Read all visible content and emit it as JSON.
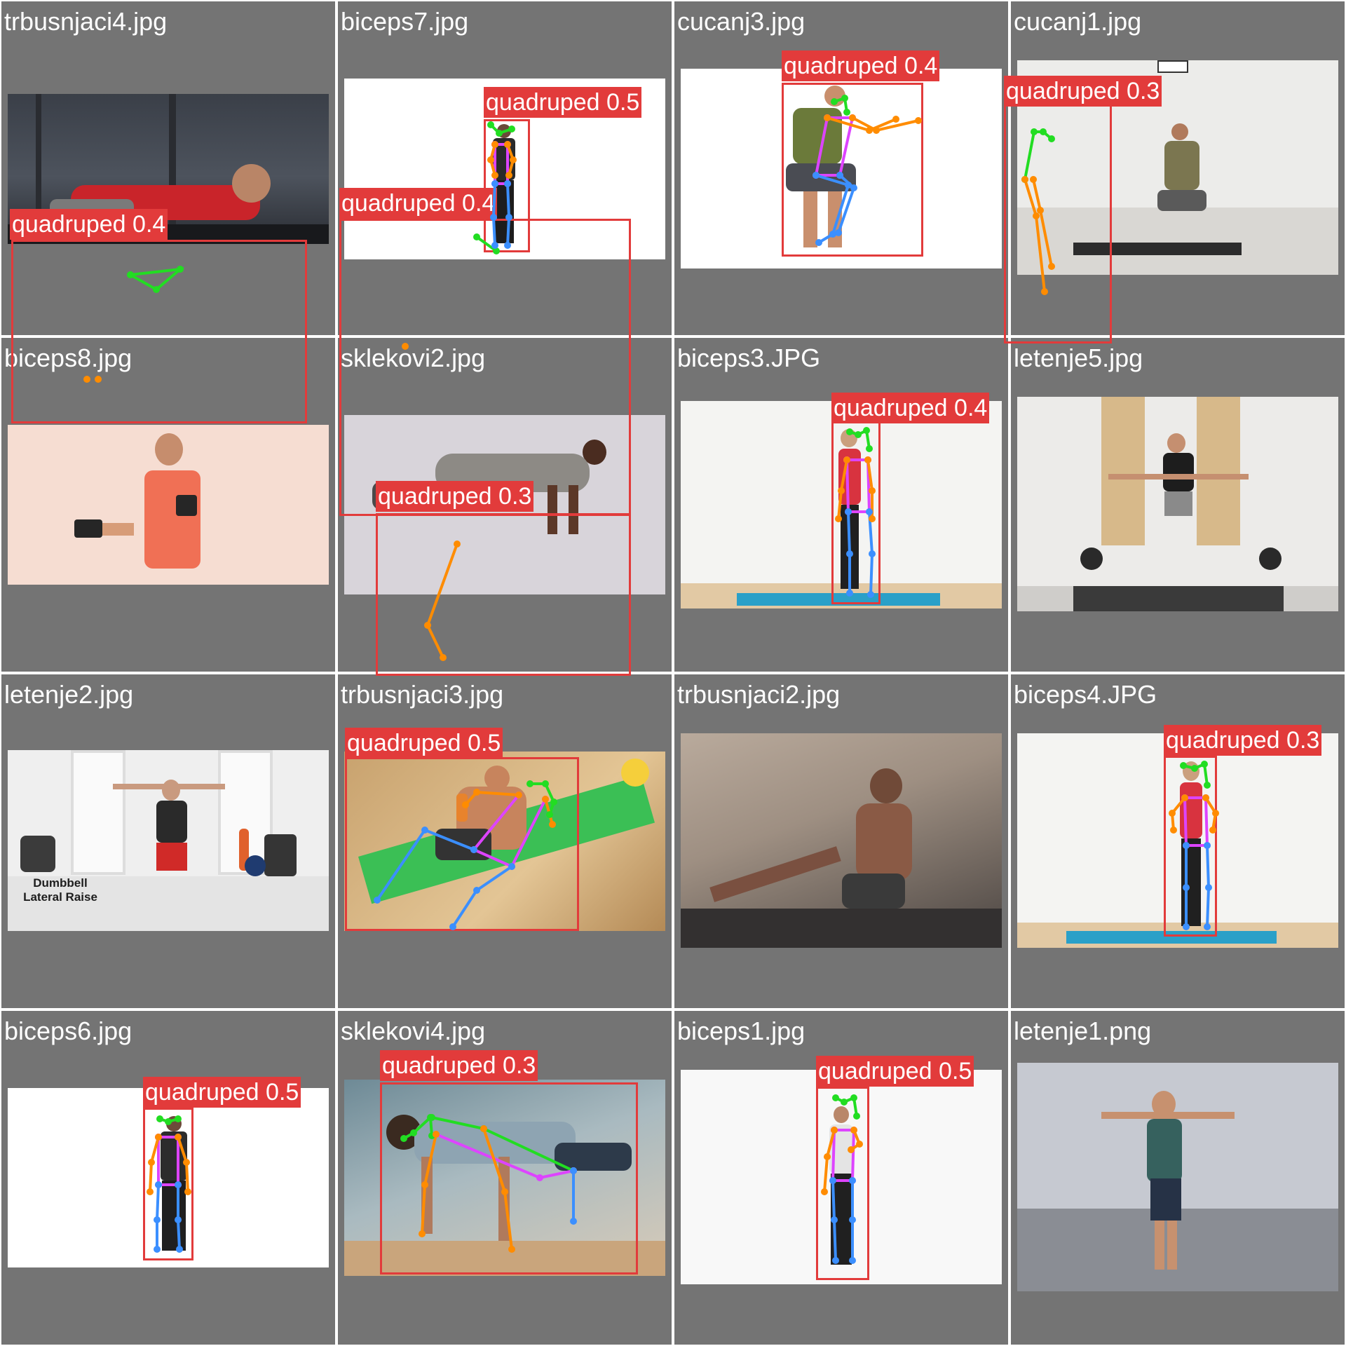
{
  "colors": {
    "tile_bg": "#747474",
    "box": "#e23b3b",
    "kp_limb_face": "#22dd22",
    "kp_limb_arm": "#ff8c00",
    "kp_limb_body": "#dd44ff",
    "kp_limb_leg": "#3b8fff"
  },
  "tiles": [
    {
      "filename": "trbusnjaci4.jpg",
      "detections": [
        "quadruped 0.4"
      ]
    },
    {
      "filename": "biceps7.jpg",
      "detections": [
        "quadruped 0.5",
        "quadruped 0.4"
      ]
    },
    {
      "filename": "cucanj3.jpg",
      "detections": [
        "quadruped 0.4"
      ]
    },
    {
      "filename": "cucanj1.jpg",
      "detections": [
        "quadruped 0.3"
      ]
    },
    {
      "filename": "biceps8.jpg",
      "detections": []
    },
    {
      "filename": "sklekovi2.jpg",
      "detections": [
        "quadruped 0.3"
      ]
    },
    {
      "filename": "biceps3.JPG",
      "detections": [
        "quadruped 0.4"
      ]
    },
    {
      "filename": "letenje5.jpg",
      "detections": []
    },
    {
      "filename": "letenje2.jpg",
      "detections": [],
      "caption": "Dumbbell\nLateral Raise"
    },
    {
      "filename": "trbusnjaci3.jpg",
      "detections": [
        "quadruped 0.5"
      ]
    },
    {
      "filename": "trbusnjaci2.jpg",
      "detections": []
    },
    {
      "filename": "biceps4.JPG",
      "detections": [
        "quadruped 0.3"
      ]
    },
    {
      "filename": "biceps6.jpg",
      "detections": [
        "quadruped 0.5"
      ]
    },
    {
      "filename": "sklekovi4.jpg",
      "detections": [
        "quadruped 0.3"
      ]
    },
    {
      "filename": "biceps1.jpg",
      "detections": [
        "quadruped 0.5"
      ]
    },
    {
      "filename": "letenje1.png",
      "detections": []
    }
  ]
}
